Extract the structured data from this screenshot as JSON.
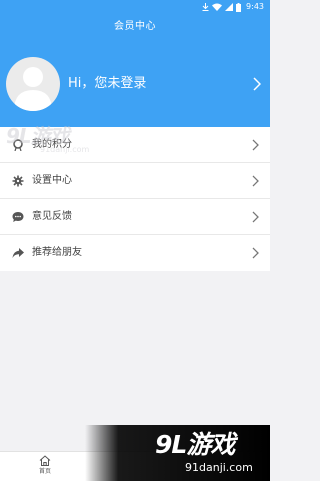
{
  "status_bar": {
    "time": "9:43",
    "icons": [
      "download-icon",
      "wifi-icon",
      "signal-icon",
      "battery-icon"
    ]
  },
  "header": {
    "title": "会员中心",
    "background_color": "#3ea2f4"
  },
  "profile": {
    "login_prompt": "Hi，您未登录",
    "avatar_icon": "default-avatar-icon",
    "arrow_icon": "chevron-right-icon"
  },
  "menu": {
    "items": [
      {
        "label": "我的积分",
        "icon": "points-icon"
      },
      {
        "label": "设置中心",
        "icon": "gear-icon"
      },
      {
        "label": "意见反馈",
        "icon": "feedback-bubble-icon"
      },
      {
        "label": "推荐给朋友",
        "icon": "share-arrow-icon"
      }
    ],
    "arrow_icon": "chevron-right-icon"
  },
  "tabbar": {
    "home_label": "首页",
    "home_icon": "home-icon"
  },
  "watermarks": {
    "logo_text": "9L游戏",
    "url_text": "91danji.com"
  }
}
